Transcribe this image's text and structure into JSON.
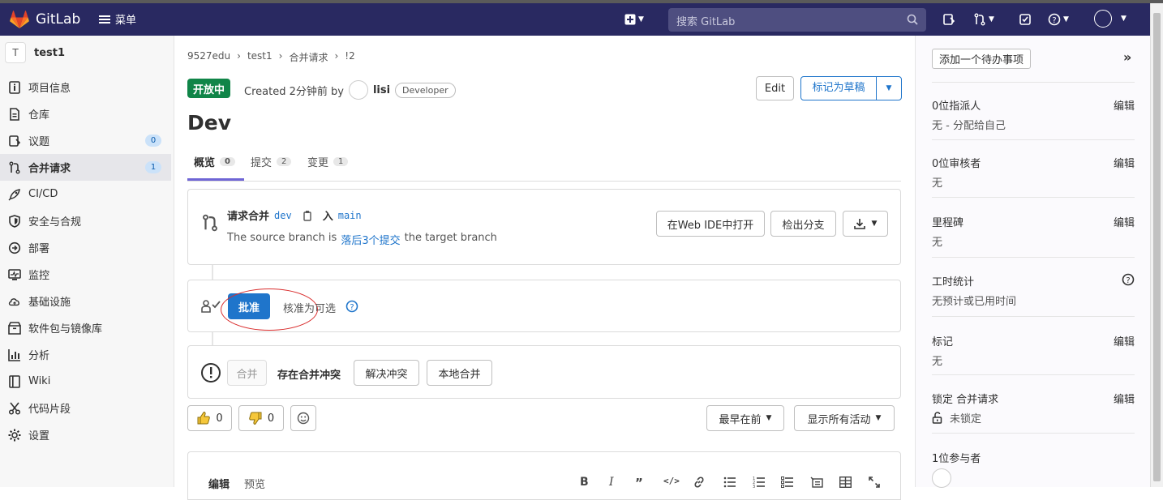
{
  "nav": {
    "brand": "GitLab",
    "menu_label": "菜单",
    "search_placeholder": "搜索 GitLab"
  },
  "sidebar": {
    "project_initial": "T",
    "project_name": "test1",
    "items": [
      {
        "label": "项目信息",
        "icon": "info-icon"
      },
      {
        "label": "仓库",
        "icon": "repository-icon"
      },
      {
        "label": "议题",
        "icon": "issues-icon",
        "badge": "0"
      },
      {
        "label": "合并请求",
        "icon": "merge-request-icon",
        "badge": "1",
        "active": true
      },
      {
        "label": "CI/CD",
        "icon": "rocket-icon"
      },
      {
        "label": "安全与合规",
        "icon": "shield-icon"
      },
      {
        "label": "部署",
        "icon": "deploy-icon"
      },
      {
        "label": "监控",
        "icon": "monitor-icon"
      },
      {
        "label": "基础设施",
        "icon": "cloud-icon"
      },
      {
        "label": "软件包与镜像库",
        "icon": "package-icon"
      },
      {
        "label": "分析",
        "icon": "chart-icon"
      },
      {
        "label": "Wiki",
        "icon": "book-icon"
      },
      {
        "label": "代码片段",
        "icon": "scissors-icon"
      },
      {
        "label": "设置",
        "icon": "gear-icon"
      }
    ]
  },
  "breadcrumbs": [
    "9527edu",
    "test1",
    "合并请求",
    "!2"
  ],
  "mr": {
    "status": "开放中",
    "created_prefix": "Created 2分钟前 by",
    "author": "lisi",
    "role": "Developer",
    "edit_label": "Edit",
    "draft_label": "标记为草稿",
    "title": "Dev",
    "tabs": [
      {
        "label": "概览",
        "count": "0"
      },
      {
        "label": "提交",
        "count": "2"
      },
      {
        "label": "变更",
        "count": "1"
      }
    ]
  },
  "widget": {
    "request_label": "请求合并",
    "source_branch": "dev",
    "into_label": "入",
    "target_branch": "main",
    "behind_prefix": "The source branch is",
    "behind_link": "落后3个提交",
    "behind_suffix": "the target branch",
    "web_ide": "在Web IDE中打开",
    "checkout": "检出分支"
  },
  "approval": {
    "approve_label": "批准",
    "optional_text": "核准为可选"
  },
  "merge": {
    "merge_label": "合并",
    "conflict_text": "存在合并冲突",
    "resolve_label": "解决冲突",
    "local_merge_label": "本地合并"
  },
  "reactions": {
    "thumbs_up": "0",
    "thumbs_down": "0",
    "sort_label": "最早在前",
    "filter_label": "显示所有活动"
  },
  "editor": {
    "write_tab": "编辑",
    "preview_tab": "预览"
  },
  "right": {
    "todo_label": "添加一个待办事项",
    "sections": [
      {
        "label": "0位指派人",
        "value": "无 - 分配给自己",
        "edit": "编辑"
      },
      {
        "label": "0位审核者",
        "value": "无",
        "edit": "编辑"
      },
      {
        "label": "里程碑",
        "value": "无",
        "edit": "编辑"
      },
      {
        "label": "工时统计",
        "value": "无预计或已用时间",
        "edit": ""
      },
      {
        "label": "标记",
        "value": "无",
        "edit": "编辑"
      },
      {
        "label": "锁定 合并请求",
        "value": "未锁定",
        "edit": "编辑"
      },
      {
        "label": "1位参与者",
        "value": "",
        "edit": ""
      }
    ]
  }
}
